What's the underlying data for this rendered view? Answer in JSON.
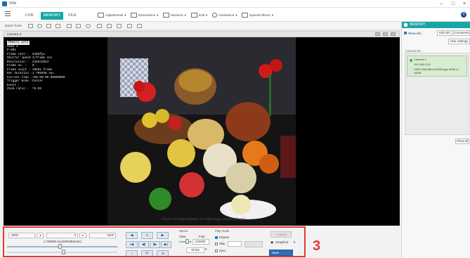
{
  "app": {
    "title": "iVilix"
  },
  "window_controls": {
    "minimize": "–",
    "maximize": "□",
    "close": "×"
  },
  "top_tabs": [
    {
      "label": "LIVE",
      "active": false
    },
    {
      "label": "MEMORY",
      "active": true
    },
    {
      "label": "FILE",
      "active": false
    }
  ],
  "menu": [
    {
      "label": "Adjustments",
      "icon": "adjustments-icon"
    },
    {
      "label": "Dimensions",
      "icon": "dimensions-icon"
    },
    {
      "label": "Monitors",
      "icon": "monitors-icon"
    },
    {
      "label": "Edit",
      "icon": "edit-icon"
    },
    {
      "label": "Assistance",
      "icon": "assistance-icon"
    },
    {
      "label": "Special effects",
      "icon": "special-effects-icon"
    }
  ],
  "help": "?",
  "quick_tools": {
    "label": "Quick Tools"
  },
  "camera": {
    "title": "Camera 2"
  },
  "info_panel": {
    "heading": "Memory info",
    "rows": [
      [
        "Head 1",
        ""
      ],
      [
        "P-001",
        ""
      ],
      [
        "Frame rate :",
        "6400fps"
      ],
      [
        "Shutter speed :",
        "1/frame sec"
      ],
      [
        "Resolution :",
        "2336x2024"
      ],
      [
        "Frame no. :",
        "0"
      ],
      [
        "Frame count :",
        "10601 frame"
      ],
      [
        "Rec duration :",
        "1.705936 sec"
      ],
      [
        "Current time :",
        "+00:00:00.00000000"
      ],
      [
        "Trigger mode :",
        "Center"
      ],
      [
        "Event :",
        "-"
      ],
      [
        "Zoom ratio :",
        "76.08"
      ]
    ]
  },
  "watermark": "Pictures for High Definition TV (Still-Image sample): (Zoom)",
  "right_panel": {
    "header": "MEMORY",
    "show_info": "Show info",
    "edit_info": "Edit info",
    "comments": "Comments",
    "user_settings": "User Settings",
    "camera_list_label": "Camera list",
    "camera_item": {
      "name": "Camera 2",
      "ip": "192.168.0.20",
      "model": "FASTCAM Mini AX200 type 900K-C-16GB"
    },
    "show_all": "Show all"
  },
  "playback": {
    "start_field": "-5000",
    "current_field": "0",
    "end_field": "5400",
    "time_label": "1.705936 sec(10916frames)",
    "position_fraction": 0.48,
    "buttons_row1": [
      "◀",
      "⏸",
      "▶"
    ],
    "buttons_row2": [
      "|◀",
      "◀|",
      "|▶",
      "▶|"
    ],
    "buttons_row3": [
      "↕",
      "⇱",
      "⇲"
    ]
  },
  "speed": {
    "title": "Speed",
    "slow": "Slow",
    "fast": "Fast",
    "value": "1/20000",
    "fps": "30 fps"
  },
  "play_mode": {
    "title": "Play mode",
    "repeat": "Repeat",
    "skip": "Skip",
    "sync": "Sync"
  },
  "actions": {
    "analysis": "Analysis",
    "snapshot": "Snapshot",
    "save": "Save"
  },
  "callout_number": "3",
  "colors": {
    "accent": "#18a6a6",
    "callout": "#e53935",
    "save_blue": "#2f6db5"
  }
}
